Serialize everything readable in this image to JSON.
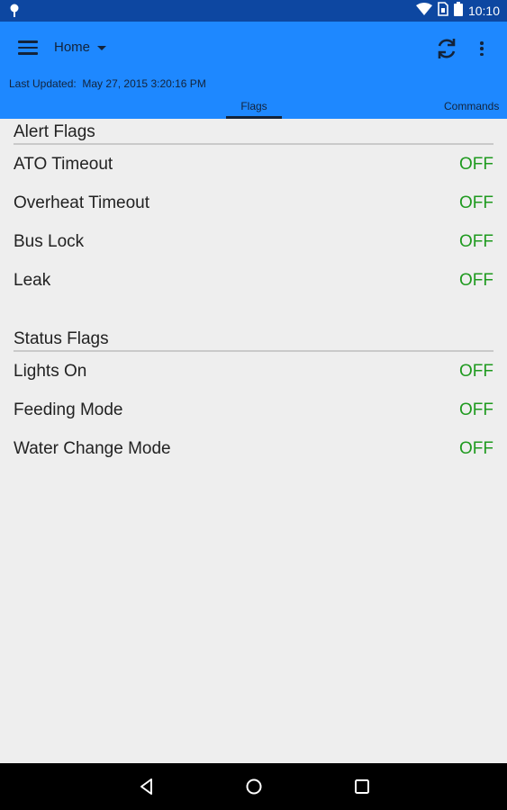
{
  "status_bar": {
    "time": "10:10",
    "left_icon": "location-pin-icon",
    "icons": [
      "wifi-icon",
      "sim-icon",
      "battery-icon"
    ]
  },
  "appbar": {
    "menu_icon": "hamburger-menu-icon",
    "title": "Home",
    "refresh_icon": "refresh-icon",
    "overflow_icon": "overflow-menu-icon",
    "last_updated_label": "Last Updated:",
    "last_updated_value": "May 27, 2015 3:20:16 PM",
    "background_color": "#1e88ff",
    "status_bar_color": "#0d47a1"
  },
  "tabs": [
    {
      "label": "Flags",
      "selected": true
    },
    {
      "label": "Commands",
      "selected": false
    }
  ],
  "alert_flags": {
    "title": "Alert Flags",
    "items": [
      {
        "label": "ATO Timeout",
        "value": "OFF"
      },
      {
        "label": "Overheat Timeout",
        "value": "OFF"
      },
      {
        "label": "Bus Lock",
        "value": "OFF"
      },
      {
        "label": "Leak",
        "value": "OFF"
      }
    ]
  },
  "status_flags": {
    "title": "Status Flags",
    "items": [
      {
        "label": "Lights On",
        "value": "OFF"
      },
      {
        "label": "Feeding Mode",
        "value": "OFF"
      },
      {
        "label": "Water Change Mode",
        "value": "OFF"
      }
    ]
  },
  "off_color": "#1f9a1f",
  "navbar": {
    "buttons": [
      "back-icon",
      "home-icon",
      "recents-icon"
    ]
  }
}
